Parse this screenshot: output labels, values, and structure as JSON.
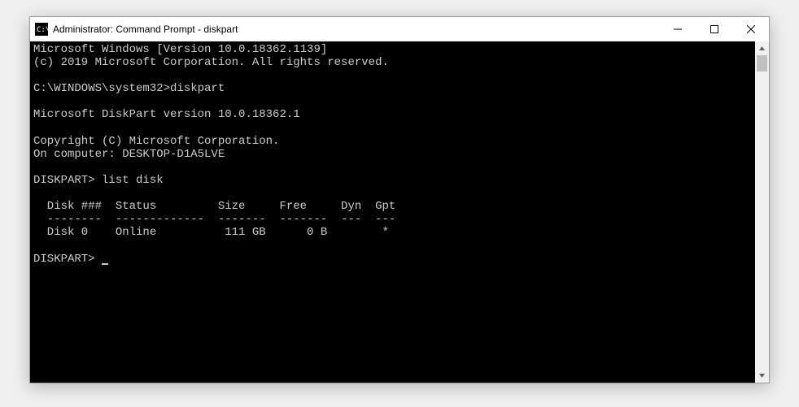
{
  "window": {
    "title": "Administrator: Command Prompt - diskpart"
  },
  "console": {
    "lines": {
      "l0": "Microsoft Windows [Version 10.0.18362.1139]",
      "l1": "(c) 2019 Microsoft Corporation. All rights reserved.",
      "l2": "",
      "l3": "C:\\WINDOWS\\system32>diskpart",
      "l4": "",
      "l5": "Microsoft DiskPart version 10.0.18362.1",
      "l6": "",
      "l7": "Copyright (C) Microsoft Corporation.",
      "l8": "On computer: DESKTOP-D1A5LVE",
      "l9": "",
      "l10": "DISKPART> list disk",
      "l11": "",
      "l12": "  Disk ###  Status         Size     Free     Dyn  Gpt",
      "l13": "  --------  -------------  -------  -------  ---  ---",
      "l14": "  Disk 0    Online          111 GB      0 B        *",
      "l15": "",
      "l16": "DISKPART> "
    }
  }
}
